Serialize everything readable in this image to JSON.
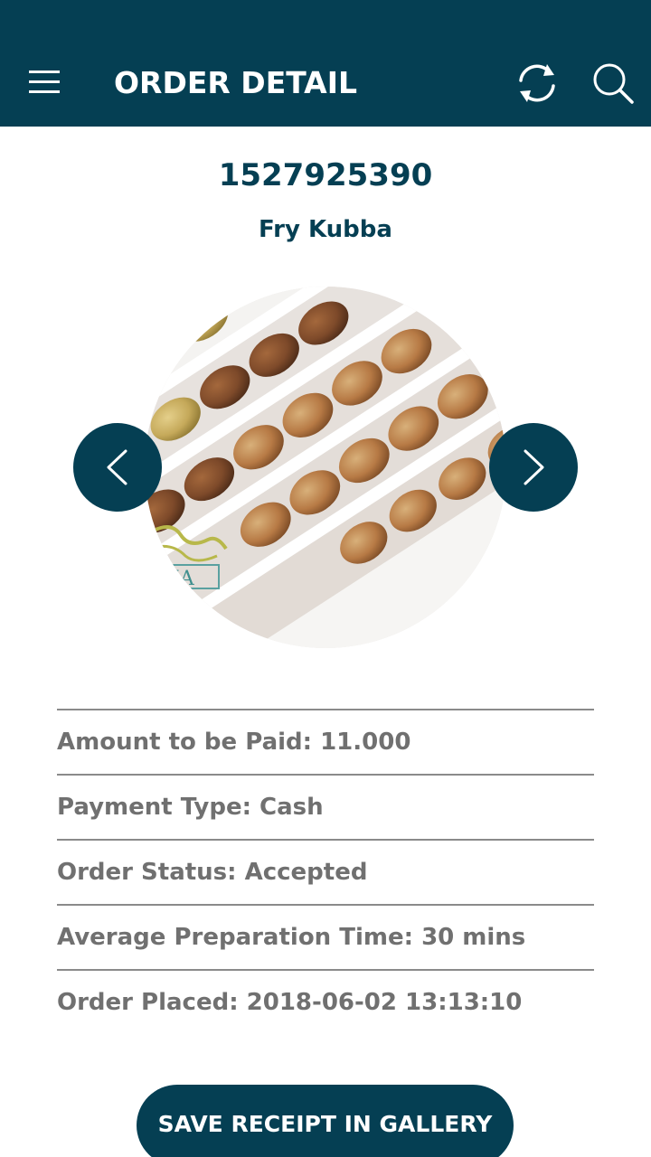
{
  "app_bar": {
    "title": "ORDER DETAIL",
    "background": "#053f53",
    "icons": [
      "menu-icon",
      "refresh-icon",
      "search-icon"
    ]
  },
  "order": {
    "id": "1527925390",
    "product_name": "Fry Kubba",
    "photo": "fried-kubba-box-photo"
  },
  "carousel": {
    "prev_icon": "chevron-left-icon",
    "next_icon": "chevron-right-icon"
  },
  "details": {
    "amount": "Amount to be Paid: 11.000",
    "payment_type": "Payment Type: Cash",
    "status": "Order Status: Accepted",
    "prep_time": "Average Preparation Time: 30 mins",
    "placed": "Order Placed: 2018-06-02 13:13:10"
  },
  "actions": {
    "save_receipt": "SAVE RECEIPT IN GALLERY"
  },
  "colors": {
    "primary": "#053f53",
    "text_muted": "#707070",
    "divider": "#8a8a8a"
  }
}
